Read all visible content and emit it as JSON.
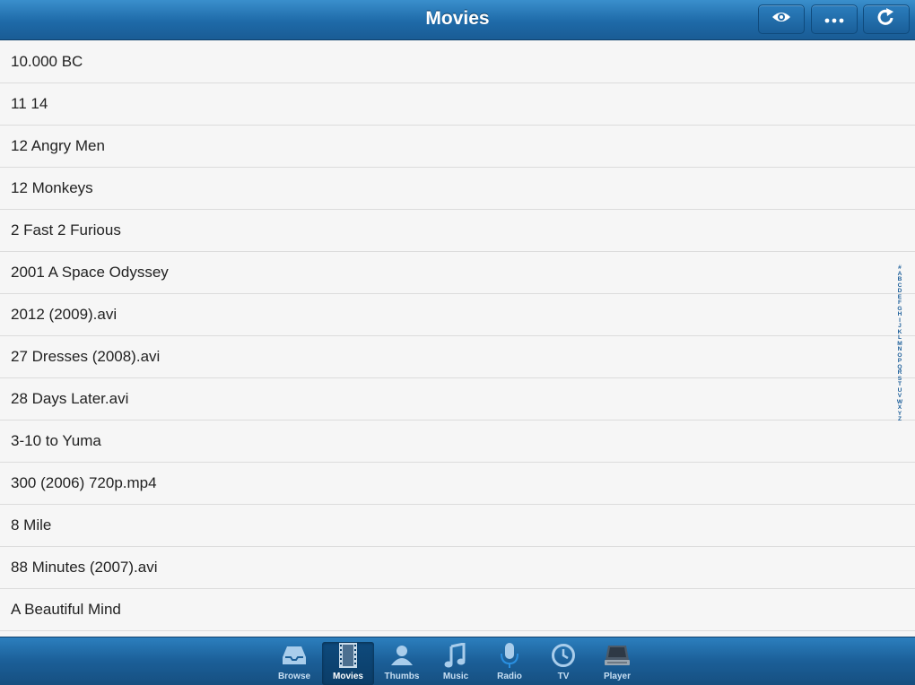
{
  "header": {
    "title": "Movies",
    "buttons": [
      "eye-icon",
      "more-icon",
      "refresh-icon"
    ]
  },
  "movies": [
    "10.000 BC",
    "11 14",
    "12 Angry Men",
    "12 Monkeys",
    "2 Fast 2 Furious",
    "2001 A Space Odyssey",
    "2012 (2009).avi",
    "27 Dresses (2008).avi",
    "28 Days Later.avi",
    "3-10 to Yuma",
    "300 (2006) 720p.mp4",
    "8 Mile",
    "88 Minutes (2007).avi",
    "A Beautiful Mind"
  ],
  "alpha_index": [
    "#",
    "A",
    "B",
    "C",
    "D",
    "E",
    "F",
    "G",
    "H",
    "I",
    "J",
    "K",
    "L",
    "M",
    "N",
    "O",
    "P",
    "Q",
    "R",
    "S",
    "T",
    "U",
    "V",
    "W",
    "X",
    "Y",
    "Z"
  ],
  "tabs": [
    {
      "label": "Browse",
      "icon": "inbox-icon"
    },
    {
      "label": "Movies",
      "icon": "film-icon"
    },
    {
      "label": "Thumbs",
      "icon": "person-icon"
    },
    {
      "label": "Music",
      "icon": "music-note-icon"
    },
    {
      "label": "Radio",
      "icon": "microphone-icon"
    },
    {
      "label": "TV",
      "icon": "clock-icon"
    },
    {
      "label": "Player",
      "icon": "player-device-icon"
    }
  ],
  "colors": {
    "accent": "#1e6aa8",
    "index_text": "#1d5f9a"
  }
}
